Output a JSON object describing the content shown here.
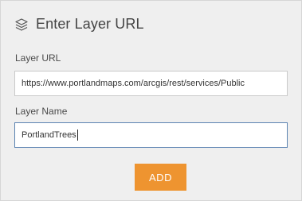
{
  "header": {
    "title": "Enter Layer URL",
    "icon": "layers-icon"
  },
  "url_field": {
    "label": "Layer URL",
    "value": "https://www.portlandmaps.com/arcgis/rest/services/Public"
  },
  "name_field": {
    "label": "Layer Name",
    "value": "PortlandTrees"
  },
  "actions": {
    "add_label": "ADD"
  },
  "colors": {
    "accent": "#ee9430",
    "focus_border": "#5b83b2",
    "panel_bg": "#efefef"
  }
}
